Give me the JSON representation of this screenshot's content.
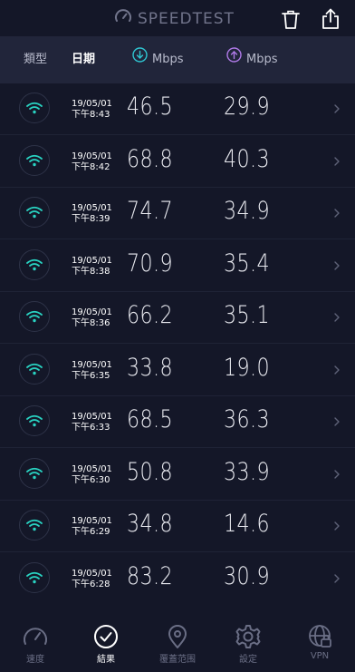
{
  "header": {
    "title": "SPEEDTEST",
    "logo_icon": "speedometer-icon",
    "trash_icon": "trash-icon",
    "share_icon": "share-icon"
  },
  "columns": {
    "type": "類型",
    "date": "日期",
    "download_unit": "Mbps",
    "upload_unit": "Mbps",
    "download_icon": "download-arrow-icon",
    "upload_icon": "upload-arrow-icon",
    "download_color": "#2fc6d2",
    "upload_color": "#b07ae8"
  },
  "results": [
    {
      "date": "19/05/01",
      "time": "下午8:43",
      "download": "46.5",
      "upload": "29.9"
    },
    {
      "date": "19/05/01",
      "time": "下午8:42",
      "download": "68.8",
      "upload": "40.3"
    },
    {
      "date": "19/05/01",
      "time": "下午8:39",
      "download": "74.7",
      "upload": "34.9"
    },
    {
      "date": "19/05/01",
      "time": "下午8:38",
      "download": "70.9",
      "upload": "35.4"
    },
    {
      "date": "19/05/01",
      "time": "下午8:36",
      "download": "66.2",
      "upload": "35.1"
    },
    {
      "date": "19/05/01",
      "time": "下午6:35",
      "download": "33.8",
      "upload": "19.0"
    },
    {
      "date": "19/05/01",
      "time": "下午6:33",
      "download": "68.5",
      "upload": "36.3"
    },
    {
      "date": "19/05/01",
      "time": "下午6:30",
      "download": "50.8",
      "upload": "33.9"
    },
    {
      "date": "19/05/01",
      "time": "下午6:29",
      "download": "34.8",
      "upload": "14.6"
    },
    {
      "date": "19/05/01",
      "time": "下午6:28",
      "download": "83.2",
      "upload": "30.9"
    }
  ],
  "tabs": [
    {
      "label": "速度",
      "icon": "speedometer-icon",
      "active": false
    },
    {
      "label": "結果",
      "icon": "checkmark-circle-icon",
      "active": true
    },
    {
      "label": "覆蓋范围",
      "icon": "map-pin-icon",
      "active": false
    },
    {
      "label": "設定",
      "icon": "gear-icon",
      "active": false
    },
    {
      "label": "VPN",
      "icon": "globe-lock-icon",
      "active": false
    }
  ],
  "colors": {
    "background": "#141728",
    "header_bar": "#21253a",
    "wifi_accent": "#29d3c2"
  }
}
